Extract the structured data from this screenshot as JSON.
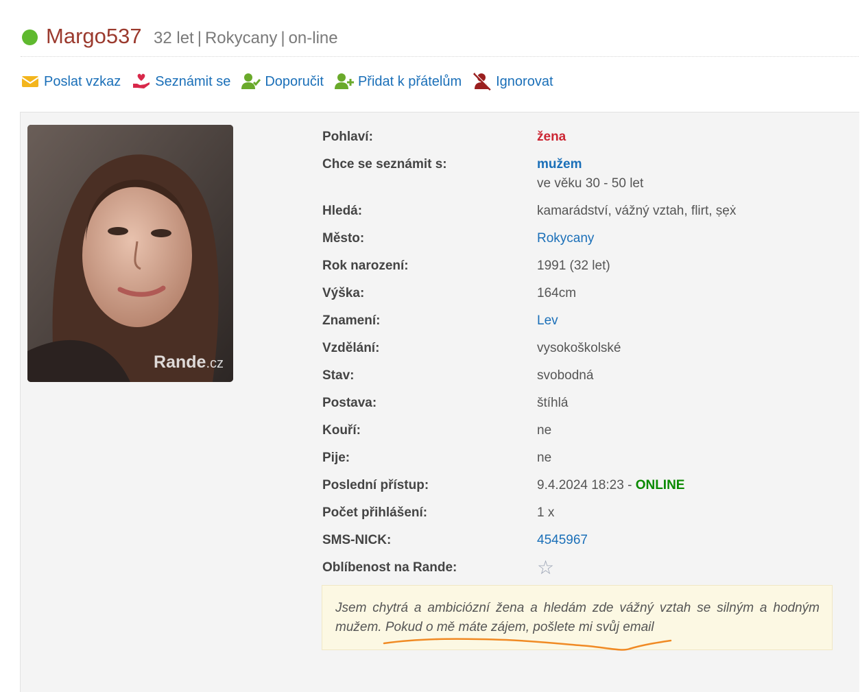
{
  "profile": {
    "username": "Margo537",
    "age": "32 let",
    "city": "Rokycany",
    "status": "on-line",
    "separator": "|"
  },
  "actions": [
    {
      "label": "Poslat vzkaz",
      "icon": "envelope-icon"
    },
    {
      "label": "Seznámit se",
      "icon": "heart-hand-icon"
    },
    {
      "label": "Doporučit",
      "icon": "user-check-icon"
    },
    {
      "label": "Přidat k přátelům",
      "icon": "user-plus-icon"
    },
    {
      "label": "Ignorovat",
      "icon": "user-block-icon"
    }
  ],
  "photo": {
    "watermark_brand": "Rande",
    "watermark_tld": ".cz"
  },
  "attributes": {
    "gender": {
      "label": "Pohlaví:",
      "value": "žena"
    },
    "wants": {
      "label": "Chce se seznámit s:",
      "value": "mužem",
      "extra": "ve věku 30 - 50 let"
    },
    "seeks": {
      "label": "Hledá:",
      "value": "kamarádství, vážný vztah, flirt, ṣẹẋ"
    },
    "city": {
      "label": "Město:",
      "value": "Rokycany"
    },
    "birth_year": {
      "label": "Rok narození:",
      "value": "1991 (32 let)"
    },
    "height": {
      "label": "Výška:",
      "value": "164cm"
    },
    "zodiac": {
      "label": "Znamení:",
      "value": "Lev"
    },
    "education": {
      "label": "Vzdělání:",
      "value": "vysokoškolské"
    },
    "marital": {
      "label": "Stav:",
      "value": "svobodná"
    },
    "figure": {
      "label": "Postava:",
      "value": "štíhlá"
    },
    "smokes": {
      "label": "Kouří:",
      "value": "ne"
    },
    "drinks": {
      "label": "Pije:",
      "value": "ne"
    },
    "last_access": {
      "label": "Poslední přístup:",
      "value": "9.4.2024 18:23",
      "dash": " - ",
      "online": "ONLINE"
    },
    "logins": {
      "label": "Počet přihlášení:",
      "value": "1 x"
    },
    "sms_nick": {
      "label": "SMS-NICK:",
      "value": "4545967"
    },
    "popularity": {
      "label": "Oblíbenost na Rande:",
      "value_stars": 0,
      "max_stars": 1
    }
  },
  "about": "Jsem chytrá a ambiciózní žena a hledám zde vážný vztah se silným a hodným mužem. Pokud o mě máte zájem, pošlete mi svůj email",
  "colors": {
    "username": "#9b3a2e",
    "link": "#1a6fb8",
    "online_dot": "#5fb92f",
    "online_text": "#0a8a00",
    "gender": "#cc2633",
    "annotation": "#f08a24"
  }
}
